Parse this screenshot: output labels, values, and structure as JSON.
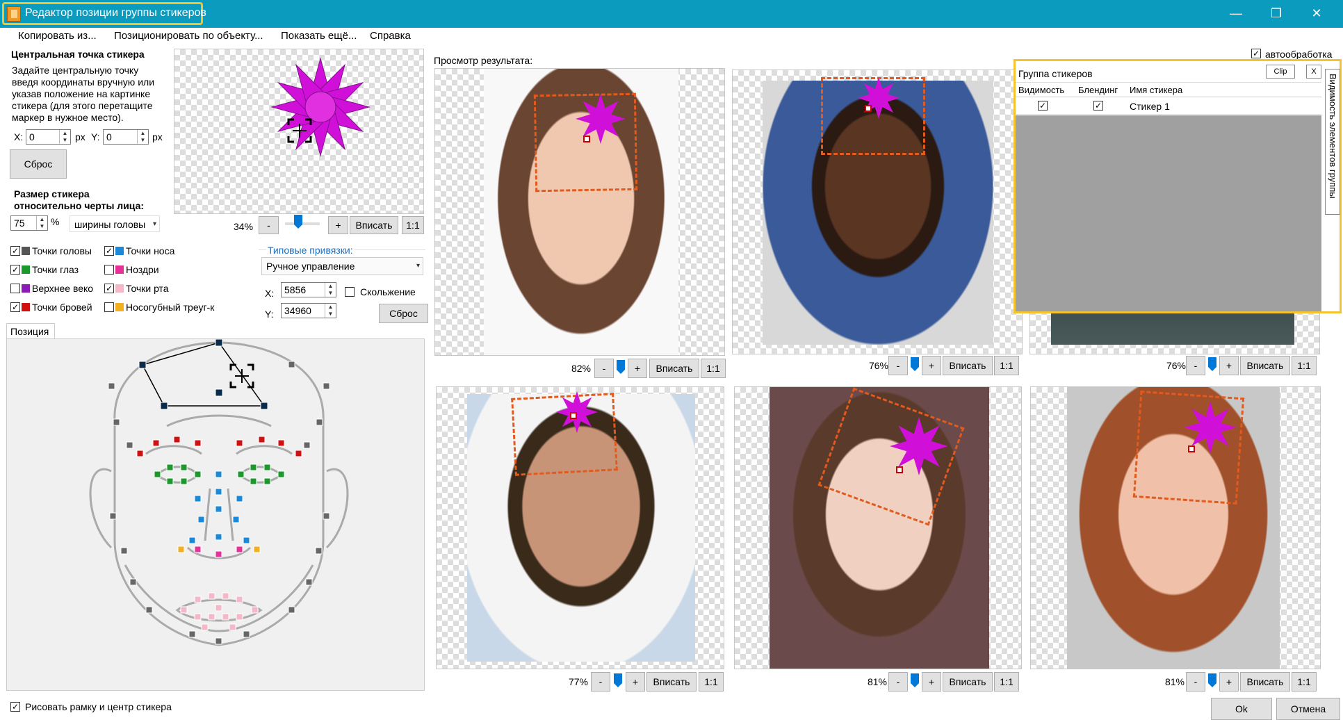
{
  "window": {
    "title": "Редактор позиции группы стикеров",
    "minimize": "—",
    "maximize": "❐",
    "close": "✕"
  },
  "menu": [
    "Копировать из...",
    "Позиционировать по объекту...",
    "Показать ещё...",
    "Справка"
  ],
  "center_point": {
    "heading": "Центральная точка стикера",
    "description": [
      "Задайте центральную точку",
      "введя координаты вручную или",
      "указав положение на картинке",
      "стикера (для этого перетащите",
      "маркер в нужное место)."
    ],
    "x_label": "X:",
    "x_value": "0",
    "x_unit": "px",
    "y_label": "Y:",
    "y_value": "0",
    "y_unit": "px",
    "reset": "Сброс"
  },
  "size": {
    "heading_line1": "Размер стикера",
    "heading_line2": "относительно черты лица:",
    "value": "75",
    "unit": "%",
    "relative_to": "ширины головы",
    "zoom": "34%",
    "minus": "-",
    "plus": "+",
    "fit": "Вписать",
    "one": "1:1"
  },
  "points": [
    {
      "label": "Точки головы",
      "checked": true,
      "color": "#555555"
    },
    {
      "label": "Точки глаз",
      "checked": true,
      "color": "#1a9a2a"
    },
    {
      "label": "Верхнее веко",
      "checked": false,
      "color": "#8b1ab8"
    },
    {
      "label": "Точки бровей",
      "checked": true,
      "color": "#d01010"
    },
    {
      "label": "Точки носа",
      "checked": true,
      "color": "#1a8ad8"
    },
    {
      "label": "Ноздри",
      "checked": false,
      "color": "#e8309a"
    },
    {
      "label": "Точки рта",
      "checked": true,
      "color": "#f4b8c8"
    },
    {
      "label": "Носогубный треуг-к",
      "checked": false,
      "color": "#f0b020"
    }
  ],
  "snap": {
    "label": "Типовые привязки:",
    "mode": "Ручное управление",
    "x_label": "X:",
    "x_value": "5856",
    "y_label": "Y:",
    "y_value": "34960",
    "sliding": "Скольжение",
    "reset": "Сброс"
  },
  "position_tab": "Позиция",
  "draw_frame": "Рисовать рамку и центр стикера",
  "preview": {
    "label": "Просмотр результата:",
    "auto": "автообработка",
    "minus": "-",
    "plus": "+",
    "fit": "Вписать",
    "one": "1:1",
    "zooms": [
      "82%",
      "76%",
      "76%",
      "77%",
      "81%",
      "81%"
    ]
  },
  "group": {
    "title": "Группа стикеров",
    "clip": "Clip",
    "close": "X",
    "columns": [
      "Видимость",
      "Блендинг",
      "Имя стикера"
    ],
    "rows": [
      {
        "visible": true,
        "blend": true,
        "name": "Стикер 1"
      }
    ],
    "side_tab": "Видимость элементов группы"
  },
  "ok": "Ok",
  "cancel": "Отмена"
}
